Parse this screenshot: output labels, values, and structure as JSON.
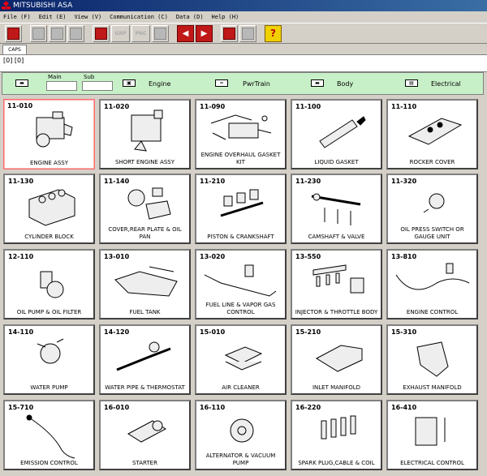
{
  "window": {
    "title": "MITSUBISHI ASA"
  },
  "menu": [
    "File (F)",
    "Edit (E)",
    "View (V)",
    "Communication (C)",
    "Data (D)",
    "Help (H)"
  ],
  "toolbar": {
    "grp_label": "GRP",
    "pnc_label": "PNC",
    "prev": "◀",
    "next": "▶",
    "help": "?"
  },
  "tab": {
    "label": "CAPS"
  },
  "path": "[0] [0]",
  "filter": {
    "main_label": "Main",
    "sub_label": "Sub",
    "engine": "Engine",
    "pwrtrain": "PwrTrain",
    "body": "Body",
    "electrical": "Electrical"
  },
  "cards": [
    {
      "code": "11-010",
      "name": "ENGINE ASSY",
      "icon": "engine-assy-icon"
    },
    {
      "code": "11-020",
      "name": "SHORT ENGINE ASSY",
      "icon": "short-engine-icon"
    },
    {
      "code": "11-090",
      "name": "ENGINE OVERHAUL GASKET KIT",
      "icon": "gasket-kit-icon"
    },
    {
      "code": "11-100",
      "name": "LIQUID GASKET",
      "icon": "liquid-gasket-icon"
    },
    {
      "code": "11-110",
      "name": "ROCKER COVER",
      "icon": "rocker-cover-icon"
    },
    {
      "code": "11-130",
      "name": "CYLINDER BLOCK",
      "icon": "cylinder-block-icon"
    },
    {
      "code": "11-140",
      "name": "COVER,REAR PLATE & OIL PAN",
      "icon": "oil-pan-icon"
    },
    {
      "code": "11-210",
      "name": "PISTON & CRANKSHAFT",
      "icon": "piston-icon"
    },
    {
      "code": "11-230",
      "name": "CAMSHAFT & VALVE",
      "icon": "camshaft-icon"
    },
    {
      "code": "11-320",
      "name": "OIL PRESS SWITCH OR GAUGE UNIT",
      "icon": "oil-switch-icon"
    },
    {
      "code": "12-110",
      "name": "OIL PUMP & OIL FILTER",
      "icon": "oil-pump-icon"
    },
    {
      "code": "13-010",
      "name": "FUEL TANK",
      "icon": "fuel-tank-icon"
    },
    {
      "code": "13-020",
      "name": "FUEL LINE & VAPOR GAS CONTROL",
      "icon": "fuel-line-icon"
    },
    {
      "code": "13-550",
      "name": "INJECTOR & THROTTLE BODY",
      "icon": "injector-icon"
    },
    {
      "code": "13-810",
      "name": "ENGINE CONTROL",
      "icon": "engine-control-icon"
    },
    {
      "code": "14-110",
      "name": "WATER PUMP",
      "icon": "water-pump-icon"
    },
    {
      "code": "14-120",
      "name": "WATER PIPE & THERMOSTAT",
      "icon": "water-pipe-icon"
    },
    {
      "code": "15-010",
      "name": "AIR CLEANER",
      "icon": "air-cleaner-icon"
    },
    {
      "code": "15-210",
      "name": "INLET MANIFOLD",
      "icon": "inlet-manifold-icon"
    },
    {
      "code": "15-310",
      "name": "EXHAUST MANIFOLD",
      "icon": "exhaust-manifold-icon"
    },
    {
      "code": "15-710",
      "name": "EMISSION CONTROL",
      "icon": "emission-icon"
    },
    {
      "code": "16-010",
      "name": "STARTER",
      "icon": "starter-icon"
    },
    {
      "code": "16-110",
      "name": "ALTERNATOR & VACUUM PUMP",
      "icon": "alternator-icon"
    },
    {
      "code": "16-220",
      "name": "SPARK PLUG,CABLE & COIL",
      "icon": "spark-plug-icon"
    },
    {
      "code": "16-410",
      "name": "ELECTRICAL CONTROL",
      "icon": "electrical-control-icon"
    }
  ]
}
